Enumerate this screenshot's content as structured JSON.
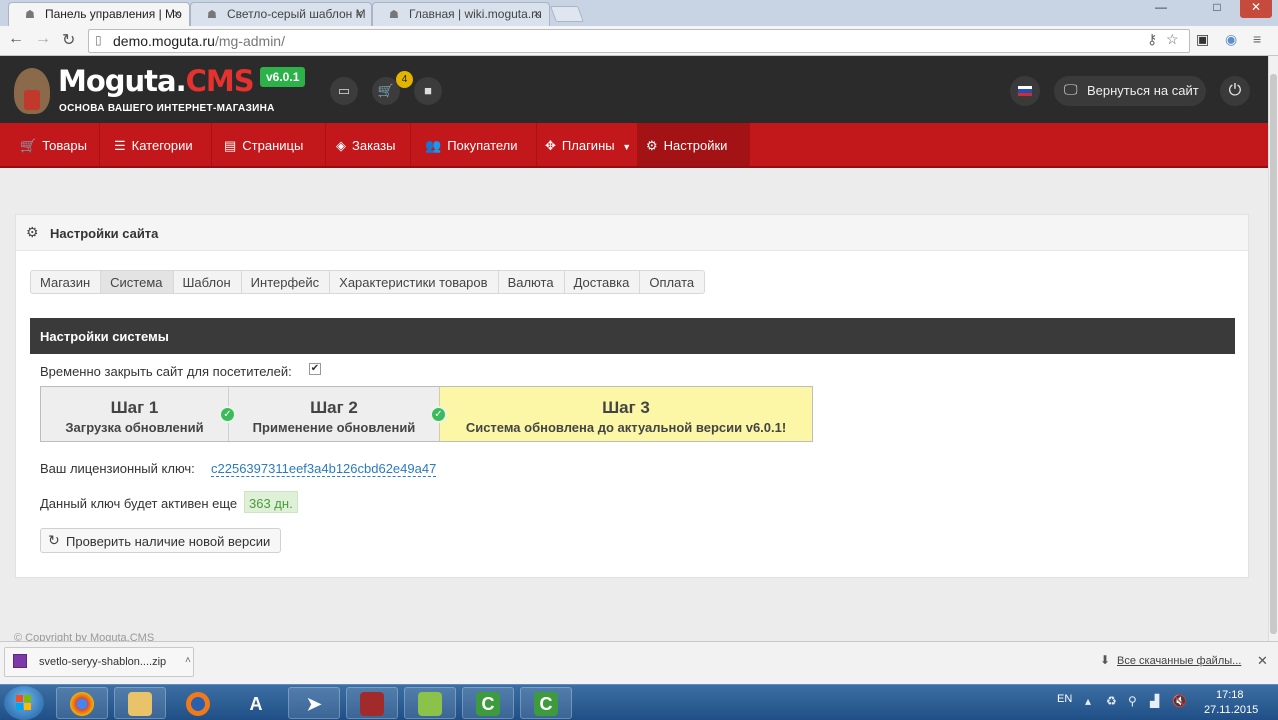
{
  "browser": {
    "tabs": [
      {
        "title": "Панель управления | Мо"
      },
      {
        "title": "Светло-серый шаблон М"
      },
      {
        "title": "Главная | wiki.moguta.ru"
      }
    ],
    "url_host": "demo.moguta.ru",
    "url_path": "/mg-admin/"
  },
  "header": {
    "logo_main": "Moguta.",
    "logo_cms": "CMS",
    "tagline": "ОСНОВА ВАШЕГО ИНТЕРНЕТ-МАГАЗИНА",
    "version": "v6.0.1",
    "cart_count": "4",
    "return_label": "Вернуться на сайт"
  },
  "nav": {
    "items": [
      {
        "label": "Товары",
        "icon": "cart-icon"
      },
      {
        "label": "Категории",
        "icon": "list-icon"
      },
      {
        "label": "Страницы",
        "icon": "page-icon"
      },
      {
        "label": "Заказы",
        "icon": "bag-icon"
      },
      {
        "label": "Покупатели",
        "icon": "users-icon"
      },
      {
        "label": "Плагины",
        "icon": "puzzle-icon"
      },
      {
        "label": "Настройки",
        "icon": "gears-icon"
      }
    ]
  },
  "settings": {
    "title": "Настройки сайта",
    "tabs": [
      "Магазин",
      "Система",
      "Шаблон",
      "Интерфейс",
      "Характеристики товаров",
      "Валюта",
      "Доставка",
      "Оплата"
    ],
    "active_tab": "Система",
    "system_title": "Настройки системы",
    "close_site_label": "Временно закрыть сайт для посетителей:",
    "close_site_checked": true,
    "steps": [
      {
        "title": "Шаг 1",
        "sub": "Загрузка обновлений"
      },
      {
        "title": "Шаг 2",
        "sub": "Применение обновлений"
      },
      {
        "title": "Шаг 3",
        "sub": "Система обновлена до актуальной версии v6.0.1!"
      }
    ],
    "license_label": "Ваш лицензионный ключ:",
    "license_key": "c2256397311eef3a4b126cbd62e49a47",
    "days_label": "Данный ключ будет активен еще",
    "days_value": "363 дн.",
    "check_button": "Проверить наличие новой версии"
  },
  "footer": {
    "copyright": "© Copyright by Moguta.CMS"
  },
  "downloads": {
    "file": "svetlo-seryy-shablon....zip",
    "all_label": "Все скачанные файлы..."
  },
  "taskbar": {
    "lang": "EN",
    "time": "17:18",
    "date": "27.11.2015"
  },
  "colors": {
    "nav_red": "#c3181b",
    "header_dark": "#2b2b2b",
    "version_green": "#2db24a",
    "step3_yellow": "#fcf7a7"
  }
}
